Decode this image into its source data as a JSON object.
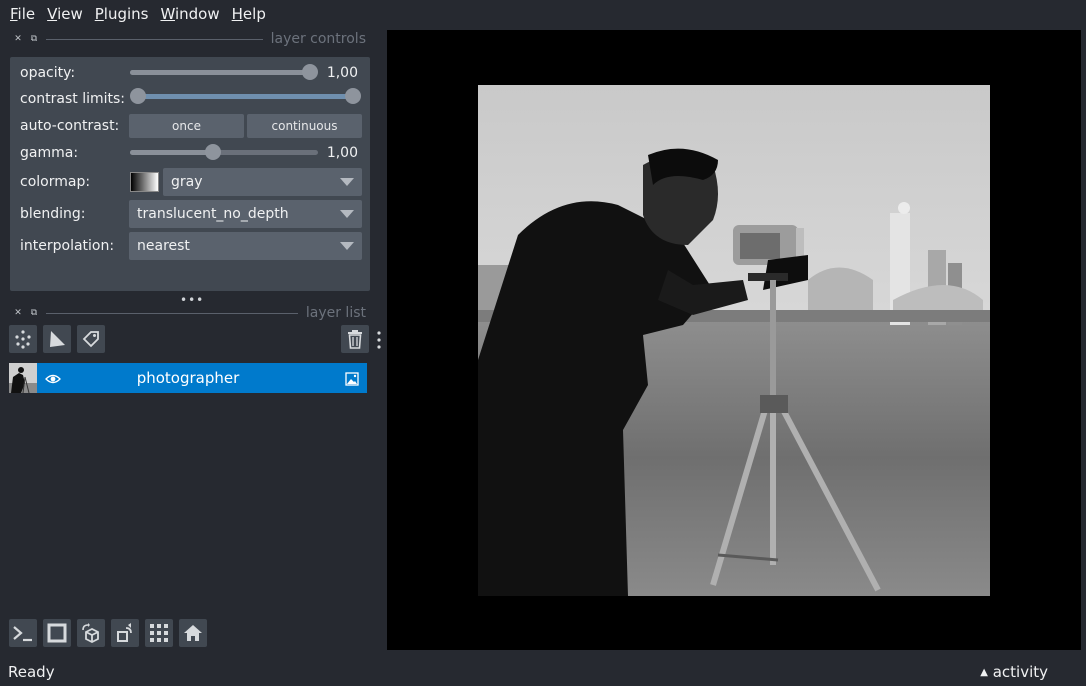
{
  "menubar": {
    "items": [
      {
        "first": "F",
        "rest": "ile"
      },
      {
        "first": "V",
        "rest": "iew"
      },
      {
        "first": "P",
        "rest": "lugins"
      },
      {
        "first": "W",
        "rest": "indow"
      },
      {
        "first": "H",
        "rest": "elp"
      }
    ]
  },
  "layer_controls": {
    "title": "layer controls",
    "opacity": {
      "label": "opacity:",
      "value": "1,00",
      "fraction": 1.0
    },
    "contrast_limits": {
      "label": "contrast limits:",
      "low": 0.0,
      "high": 1.0
    },
    "auto_contrast": {
      "label": "auto-contrast:",
      "once": "once",
      "continuous": "continuous"
    },
    "gamma": {
      "label": "gamma:",
      "value": "1,00",
      "fraction": 0.44
    },
    "colormap": {
      "label": "colormap:",
      "value": "gray"
    },
    "blending": {
      "label": "blending:",
      "value": "translucent_no_depth"
    },
    "interpolation": {
      "label": "interpolation:",
      "value": "nearest"
    }
  },
  "layer_list": {
    "title": "layer list",
    "layers": [
      {
        "name": "photographer",
        "visible": true,
        "selected": true
      }
    ]
  },
  "status": {
    "text": "Ready",
    "activity": "activity"
  },
  "colors": {
    "background": "#262930",
    "panel": "#414851",
    "selection": "#007acc",
    "canvas": "#000000"
  }
}
